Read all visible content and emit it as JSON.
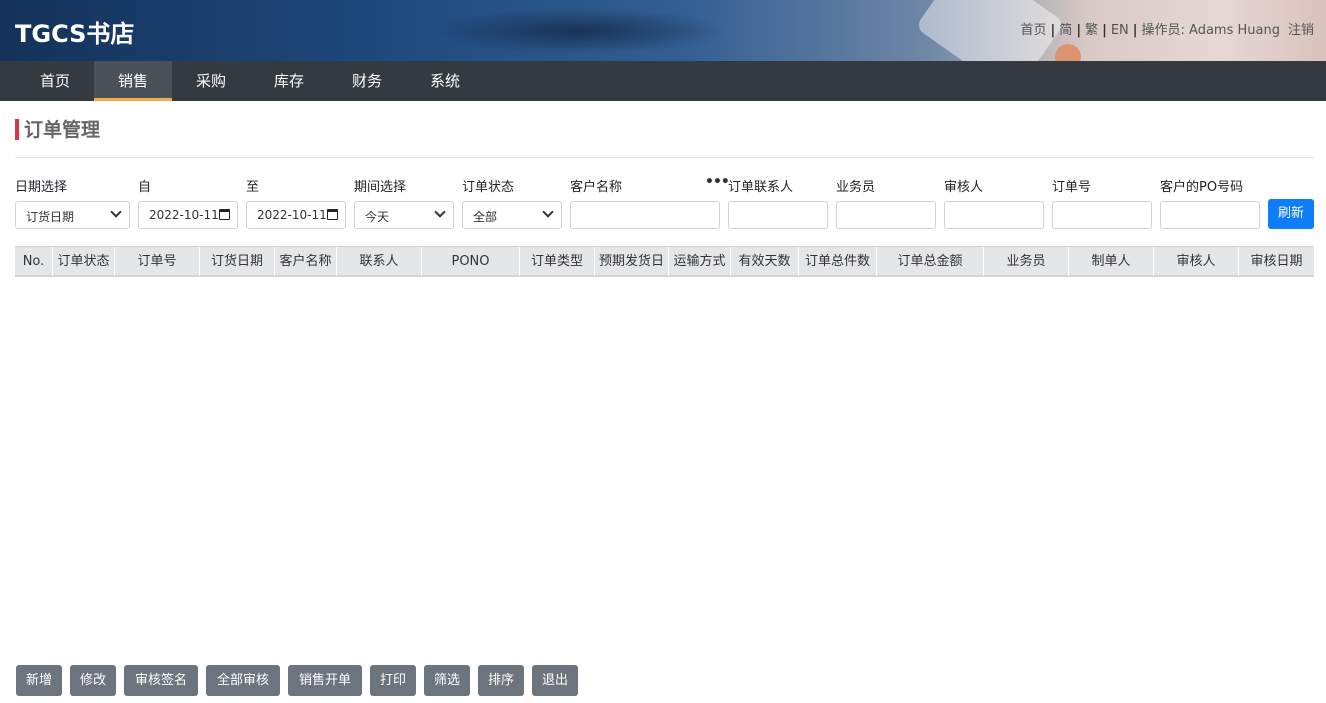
{
  "header": {
    "brand": "TGCS书店",
    "links": {
      "home": "首页",
      "simplified": "简",
      "traditional": "繁",
      "english": "EN",
      "operator_label": "操作员: ",
      "operator_name": "Adams Huang",
      "logout": "注销"
    }
  },
  "nav": {
    "items": [
      "首页",
      "销售",
      "采购",
      "库存",
      "财务",
      "系统"
    ],
    "active": "销售"
  },
  "page": {
    "title": "订单管理"
  },
  "filters": {
    "date_type": {
      "label": "日期选择",
      "value": "订货日期"
    },
    "from": {
      "label": "自",
      "value": "2022-10-11"
    },
    "to": {
      "label": "至",
      "value": "2022-10-11"
    },
    "period": {
      "label": "期间选择",
      "value": "今天"
    },
    "order_status": {
      "label": "订单状态",
      "value": "全部"
    },
    "customer_name": {
      "label": "客户名称",
      "value": ""
    },
    "customer_more": "•••",
    "contact": {
      "label": "订单联系人",
      "value": ""
    },
    "salesperson": {
      "label": "业务员",
      "value": ""
    },
    "reviewer": {
      "label": "审核人",
      "value": ""
    },
    "order_no": {
      "label": "订单号",
      "value": ""
    },
    "customer_po": {
      "label": "客户的PO号码",
      "value": ""
    },
    "refresh": "刷新"
  },
  "table": {
    "columns": [
      "No.",
      "订单状态",
      "订单号",
      "订货日期",
      "客户名称",
      "联系人",
      "PONO",
      "订单类型",
      "预期发货日",
      "运输方式",
      "有效天数",
      "订单总件数",
      "订单总金额",
      "业务员",
      "制单人",
      "审核人",
      "审核日期"
    ],
    "rows": []
  },
  "actions": [
    "新增",
    "修改",
    "审核签名",
    "全部审核",
    "销售开单",
    "打印",
    "筛选",
    "排序",
    "退出"
  ]
}
